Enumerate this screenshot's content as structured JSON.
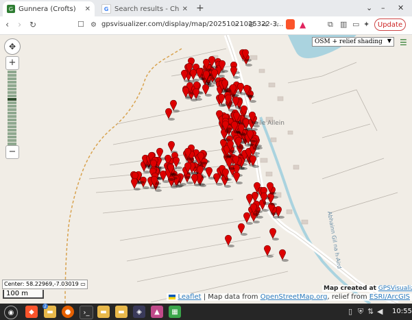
{
  "browser": {
    "tabs": [
      {
        "title": "Gunnera (Crofts)",
        "active": true,
        "favicon": "gpsvisualizer-icon"
      },
      {
        "title": "Search results - Chrome Web Sto",
        "active": false,
        "favicon": "google-icon"
      }
    ],
    "new_tab_glyph": "+",
    "url": "gpsvisualizer.com/display/map/20251021025322-3...",
    "update_label": "Update",
    "window_controls": [
      "⌄",
      "–",
      "✕"
    ]
  },
  "map": {
    "layer_selected": "OSM + relief shading",
    "place_label": "Baile Ailein",
    "stream_label": "Abhainn Gil na h-Aird",
    "center_label": "Center: 58.22969,-7.03019",
    "scale_label": "100 m",
    "credit_prefix": "Map created at",
    "credit_link": "GPSVisualizer.com",
    "attribution": {
      "leaflet": "Leaflet",
      "map_data_prefix": "| Map data from",
      "osm": "OpenStreetMap.org",
      "relief_prefix": ", relief from",
      "esri": "ESRI/ArcGIS"
    },
    "marker_color": "#dd0000"
  },
  "taskbar": {
    "clock": "10:55",
    "badge": "2"
  }
}
